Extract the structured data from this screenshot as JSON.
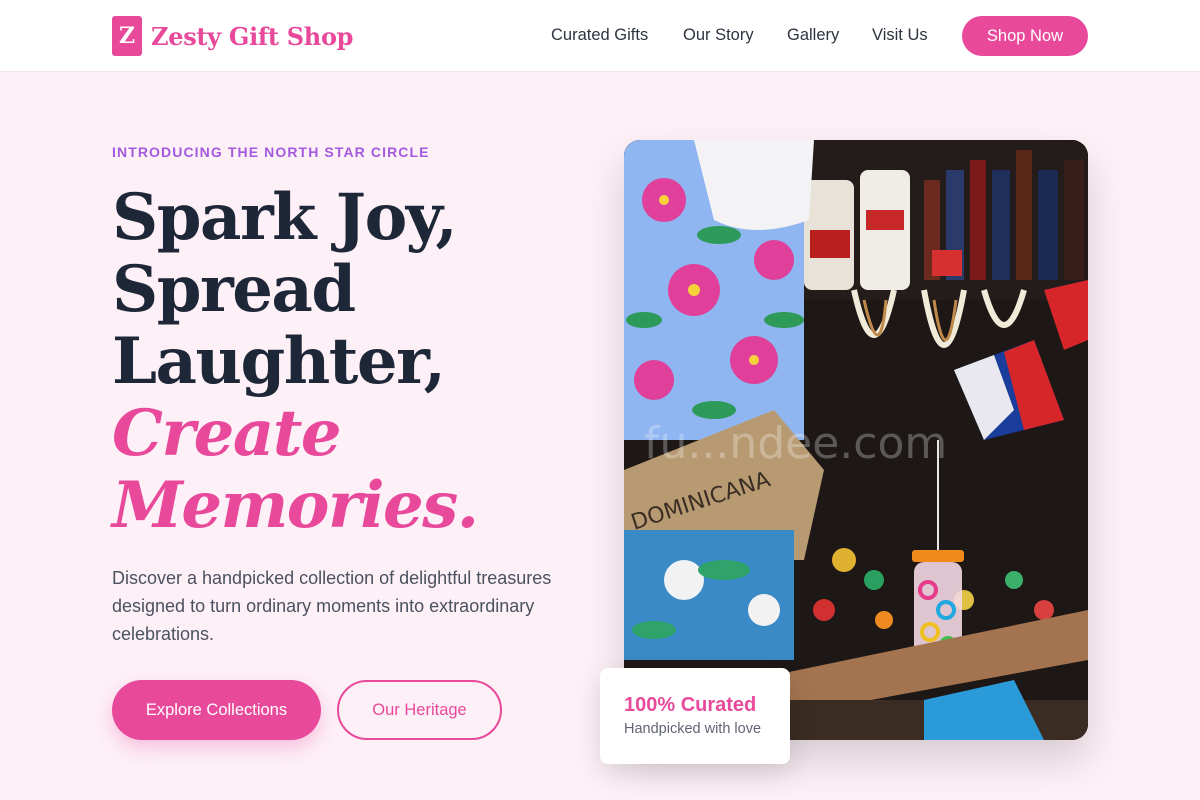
{
  "brand": {
    "logo_letter": "Z",
    "name": "Zesty Gift Shop",
    "accent_color": "#e8499a"
  },
  "nav": {
    "links": [
      "Curated Gifts",
      "Our Story",
      "Gallery",
      "Visit Us"
    ],
    "cta": "Shop Now"
  },
  "hero": {
    "eyebrow": "INTRODUCING THE NORTH STAR CIRCLE",
    "headline_lines": [
      "Spark Joy,",
      "Spread",
      "Laughter,"
    ],
    "headline_accent_lines": [
      "Create",
      "Memories."
    ],
    "description": "Discover a handpicked collection of delightful treasures designed to turn ordinary moments into extraordinary celebrations.",
    "primary_button": "Explore Collections",
    "secondary_button": "Our Heritage"
  },
  "image": {
    "watermark": "fu...ndee.com"
  },
  "badge": {
    "title": "100% Curated",
    "subtitle": "Handpicked with love"
  },
  "colors": {
    "background": "#fdf0f7",
    "eyebrow": "#a45ae0",
    "heading": "#1e2737",
    "body_text": "#4b5260"
  }
}
